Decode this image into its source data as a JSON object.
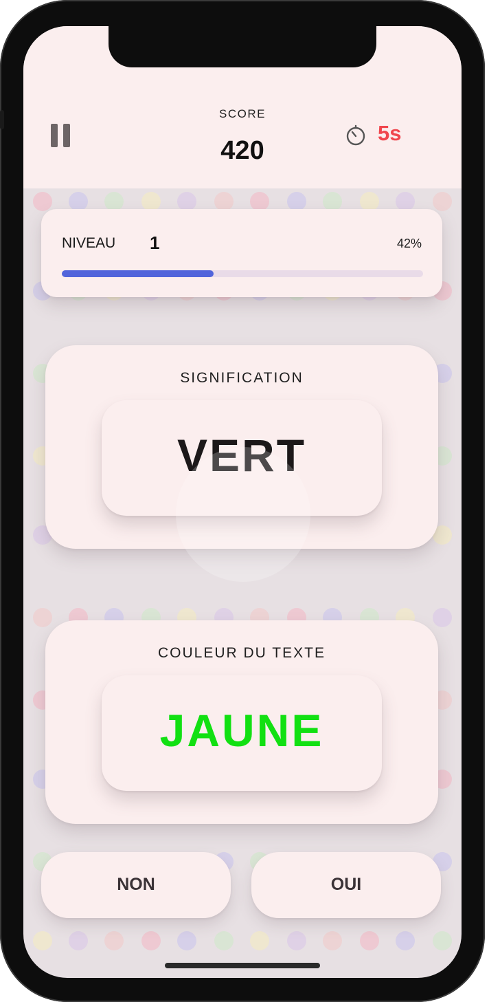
{
  "header": {
    "score_label": "SCORE",
    "score_value": "420",
    "timer": "5s",
    "timer_color": "#f0464d"
  },
  "level": {
    "label": "NIVEAU",
    "number": "1",
    "progress_text": "42%",
    "progress_fraction": 0.42,
    "bar_color": "#5164db"
  },
  "meaning_card": {
    "title": "SIGNIFICATION",
    "word": "VERT",
    "word_color": "#1c1819"
  },
  "color_card": {
    "title": "COULEUR DU TEXTE",
    "word": "JAUNE",
    "word_color": "#12e012"
  },
  "answers": {
    "no_label": "NON",
    "yes_label": "OUI"
  },
  "icons": [
    "pause-icon",
    "stopwatch-icon"
  ]
}
